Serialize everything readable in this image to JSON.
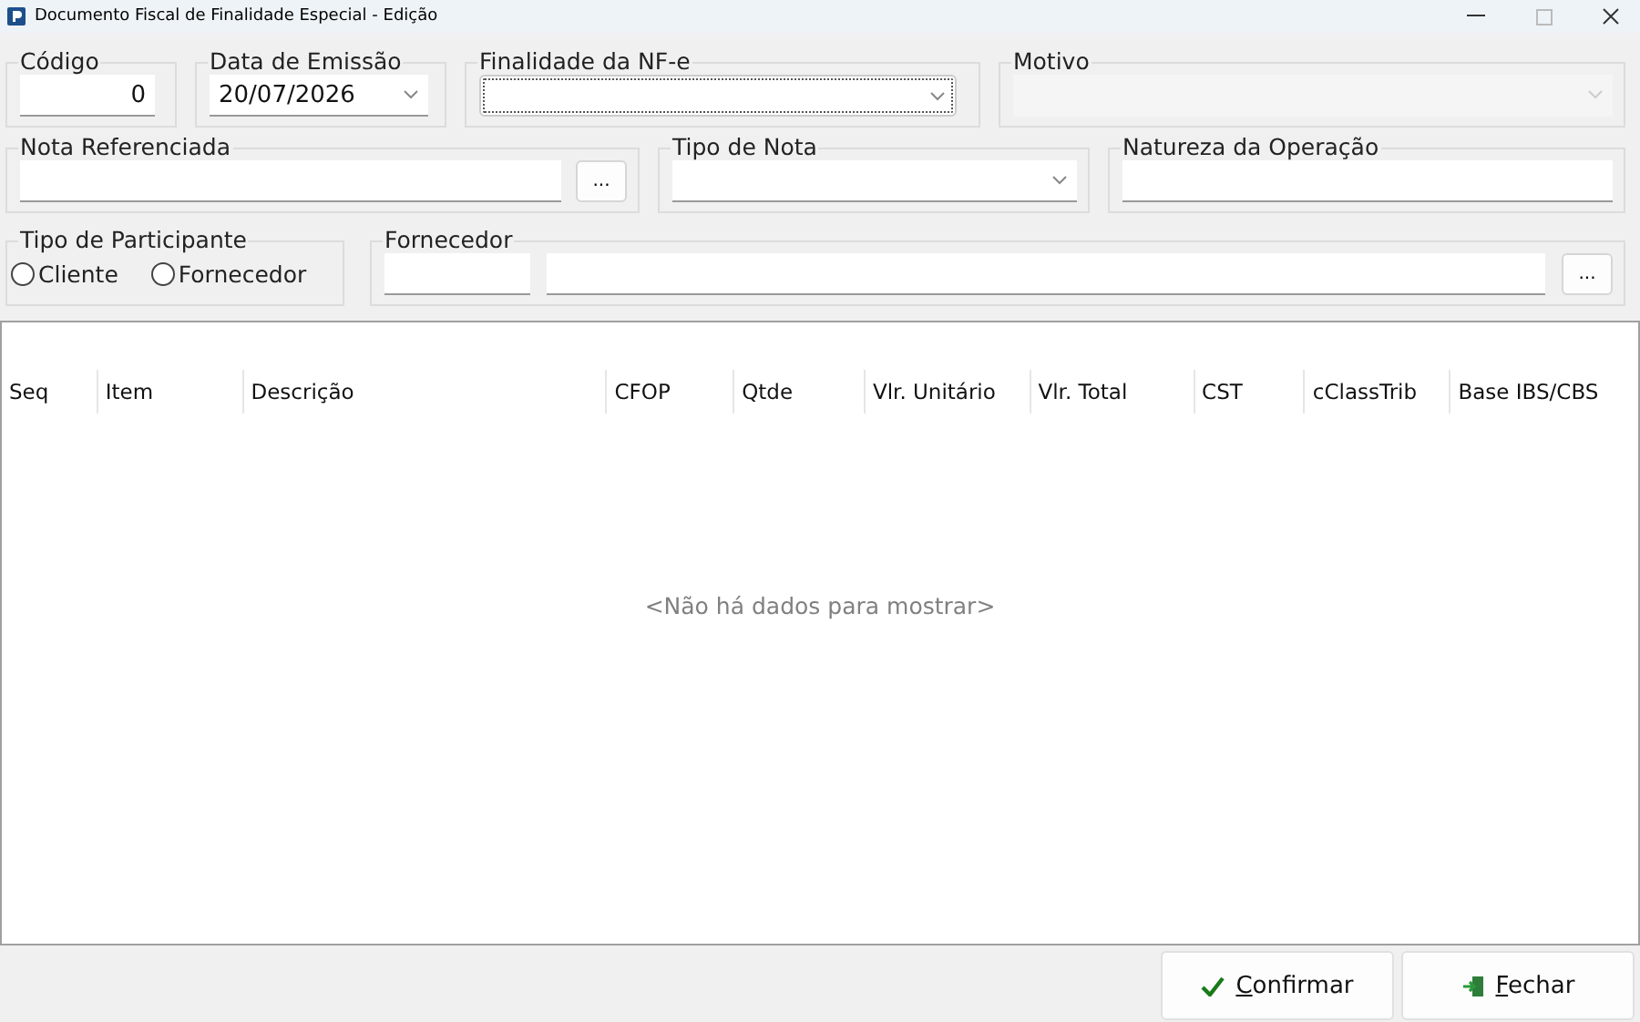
{
  "window": {
    "title": "Documento Fiscal de Finalidade Especial - Edição"
  },
  "codigo": {
    "label": "Código",
    "value": "0"
  },
  "data_emissao": {
    "label": "Data de Emissão",
    "value": "20/07/2026"
  },
  "finalidade": {
    "label": "Finalidade da NF-e",
    "focused": true
  },
  "motivo": {
    "label": "Motivo",
    "disabled": true
  },
  "nota_referenciada": {
    "label": "Nota Referenciada",
    "button": "..."
  },
  "tipo_nota": {
    "label": "Tipo de Nota"
  },
  "natureza": {
    "label": "Natureza da Operação"
  },
  "tipo_participante": {
    "label": "Tipo de Participante",
    "options": [
      {
        "label": "Cliente",
        "selected": false
      },
      {
        "label": "Fornecedor",
        "selected": false
      }
    ]
  },
  "fornecedor": {
    "label": "Fornecedor",
    "button": "..."
  },
  "table": {
    "columns": [
      "Seq",
      "Item",
      "Descrição",
      "CFOP",
      "Qtde",
      "Vlr. Unitário",
      "Vlr. Total",
      "CST",
      "cClassTrib",
      "Base IBS/CBS"
    ],
    "empty_text": "<Não há dados para mostrar>"
  },
  "buttons": [
    {
      "kind": "confirm",
      "label": "Confirmar"
    },
    {
      "kind": "close",
      "label": "Fechar"
    }
  ]
}
